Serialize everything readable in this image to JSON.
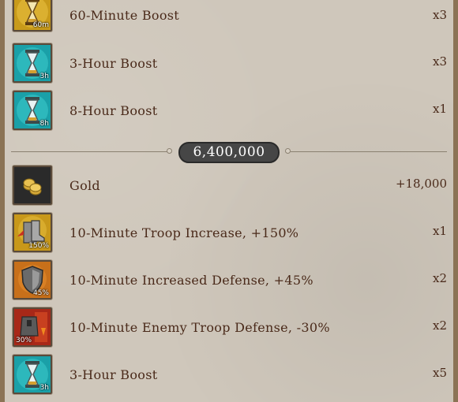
{
  "items_top": [
    {
      "label": "60-Minute Boost",
      "qty": "x3",
      "icon": "hourglass-gold-icon",
      "badge": "60m"
    },
    {
      "label": "3-Hour Boost",
      "qty": "x3",
      "icon": "hourglass-teal-icon",
      "badge": "3h"
    },
    {
      "label": "8-Hour Boost",
      "qty": "x1",
      "icon": "hourglass-teal-icon",
      "badge": "8h"
    }
  ],
  "tier": {
    "threshold": "6,400,000"
  },
  "items_bottom": [
    {
      "label": "Gold",
      "qty": "+18,000",
      "icon": "gold-coins-icon",
      "badge": ""
    },
    {
      "label": "10-Minute Troop Increase, +150%",
      "qty": "x1",
      "icon": "troop-boots-icon",
      "badge": "150%"
    },
    {
      "label": "10-Minute Increased Defense, +45%",
      "qty": "x2",
      "icon": "shield-icon",
      "badge": "45%"
    },
    {
      "label": "10-Minute Enemy Troop Defense, -30%",
      "qty": "x2",
      "icon": "broken-armor-icon",
      "badge": "30%"
    },
    {
      "label": "3-Hour Boost",
      "qty": "x5",
      "icon": "hourglass-teal-icon",
      "badge": "3h"
    }
  ],
  "colors": {
    "background": "#cfc7bb",
    "text": "#4a2a1a",
    "pill": "#464646"
  }
}
